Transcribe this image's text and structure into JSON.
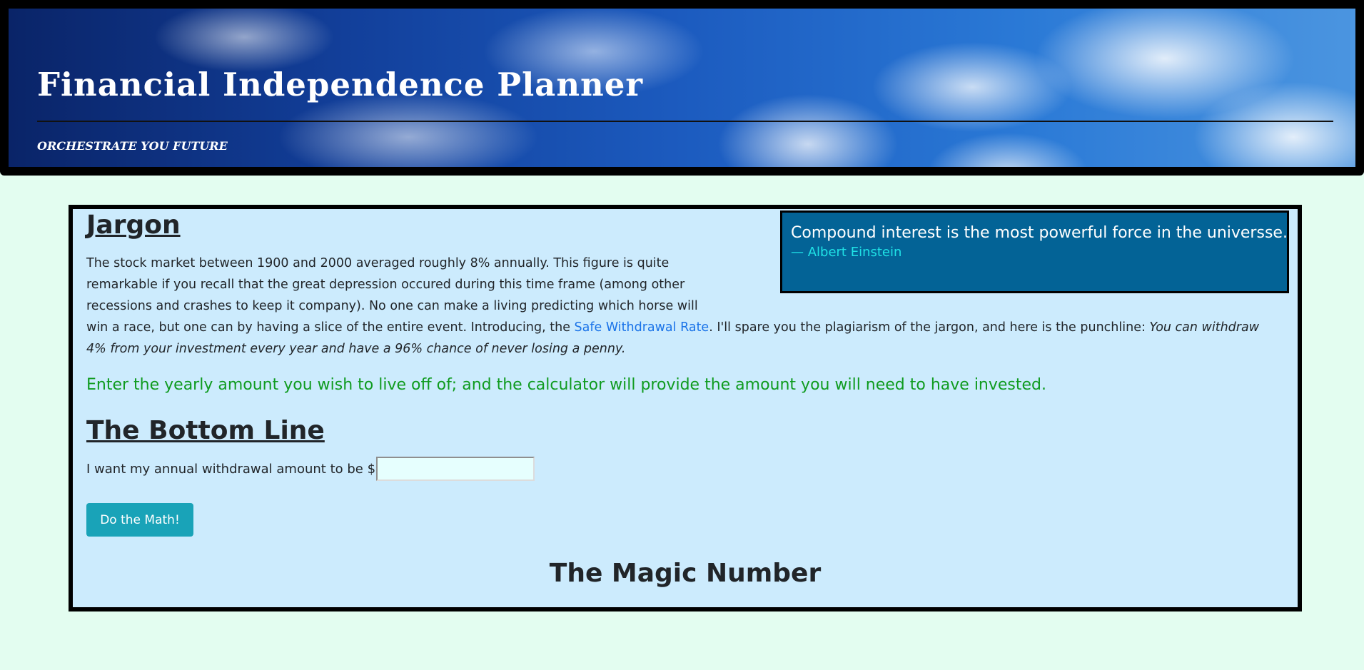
{
  "header": {
    "title": "Financial Independence Planner",
    "tagline": "ORCHESTRATE YOU FUTURE"
  },
  "quote": {
    "text": "Compound interest is the most powerful force in the universse.",
    "author": "— Albert Einstein"
  },
  "jargon": {
    "heading": "Jargon",
    "body_before_link": "The stock market between 1900 and 2000 averaged roughly 8% annually. This figure is quite remarkable if you recall that the great depression occured during this time frame (among other recessions and crashes to keep it company). No one can make a living predicting which horse will win a race, but one can by having a slice of the entire event. Introducing, the ",
    "link_text": "Safe Withdrawal Rate",
    "body_after_link": ". I'll spare you the plagiarism of the jargon, and here is the punchline: ",
    "punchline": "You can withdraw 4% from your investment every year and have a 96% chance of never losing a penny."
  },
  "instruction": "Enter the yearly amount you wish to live off of; and the calculator will provide the amount you will need to have invested.",
  "bottom_line": {
    "heading": "The Bottom Line",
    "withdraw_label": "I want my annual withdrawal amount to be $",
    "withdraw_value": "",
    "button_label": "Do the Math!"
  },
  "result": {
    "heading": "The Magic Number"
  },
  "colors": {
    "page_background": "#e3fdf0",
    "card_background": "#ccebfd",
    "quote_background": "#036396",
    "quote_author": "#1fe2e6",
    "instruction_text": "#0f9b1f",
    "link": "#1a73e8",
    "button": "#19a3b8"
  }
}
